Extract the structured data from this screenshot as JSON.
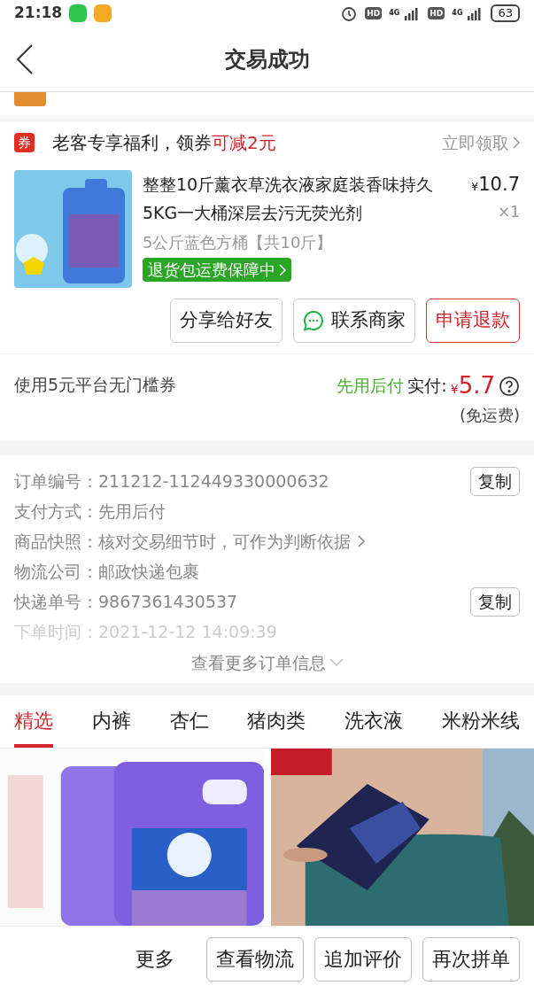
{
  "status_bar": {
    "time": "21:18",
    "hd": [
      "HD",
      "HD"
    ],
    "network": [
      "4G",
      "4G"
    ],
    "battery": "63"
  },
  "header": {
    "title": "交易成功"
  },
  "coupon": {
    "badge": "券",
    "text": "老客专享福利，领券",
    "highlight": "可减2元",
    "action": "立即领取"
  },
  "product": {
    "title": "整整10斤薰衣草洗衣液家庭装香味持久5KG一大桶深层去污无荧光剂",
    "currency": "¥",
    "price": "10.7",
    "quantity": "×1",
    "spec": "5公斤蓝色方桶【共10斤】",
    "guarantee": "退货包运费保障中",
    "buttons": [
      {
        "label": "分享给好友",
        "kind": "plain"
      },
      {
        "label": "联系商家",
        "kind": "chat"
      },
      {
        "label": "申请退款",
        "kind": "danger"
      }
    ]
  },
  "payment": {
    "coupon_note": "使用5元平台无门槛券",
    "method": "先用后付",
    "label": "实付:",
    "currency": "¥",
    "amount": "5.7",
    "shipping": "(免运费)"
  },
  "order_info": {
    "rows": [
      {
        "label": "订单编号：",
        "value": "211212-112449330000632",
        "copy": "复制",
        "link": false,
        "faded": false
      },
      {
        "label": "支付方式：",
        "value": "先用后付",
        "link": false,
        "faded": false
      },
      {
        "label": "商品快照：",
        "value": "核对交易细节时，可作为判断依据",
        "link": true,
        "faded": false
      },
      {
        "label": "物流公司：",
        "value": "邮政快递包裹",
        "link": false,
        "faded": false
      },
      {
        "label": "快递单号：",
        "value": "9867361430537",
        "copy": "复制",
        "link": false,
        "faded": false
      },
      {
        "label": "下单时间：",
        "value": "2021-12-12 14:09:39",
        "link": false,
        "faded": true
      }
    ],
    "more": "查看更多订单信息"
  },
  "tabs": [
    {
      "label": "精选",
      "selected": true
    },
    {
      "label": "内裤",
      "selected": false
    },
    {
      "label": "杏仁",
      "selected": false
    },
    {
      "label": "猪肉类",
      "selected": false
    },
    {
      "label": "洗衣液",
      "selected": false
    },
    {
      "label": "米粉米线",
      "selected": false
    }
  ],
  "bottom_bar": {
    "more": "更多",
    "buttons": [
      "查看物流",
      "追加评价",
      "再次拼单"
    ]
  }
}
